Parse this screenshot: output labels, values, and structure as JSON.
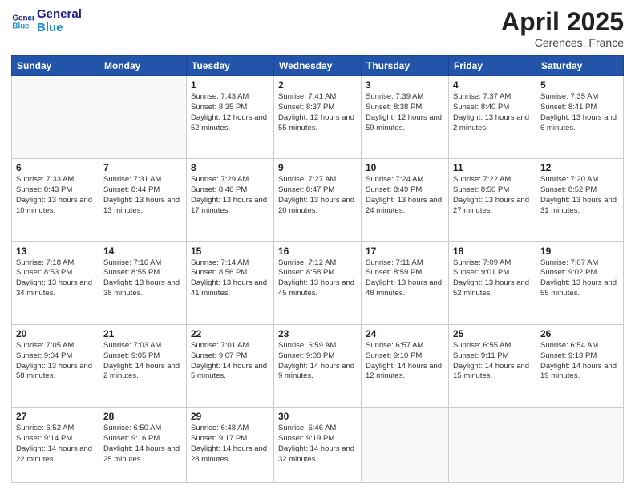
{
  "header": {
    "logo_line1": "General",
    "logo_line2": "Blue",
    "title": "April 2025",
    "subtitle": "Cerences, France"
  },
  "columns": [
    "Sunday",
    "Monday",
    "Tuesday",
    "Wednesday",
    "Thursday",
    "Friday",
    "Saturday"
  ],
  "weeks": [
    [
      {
        "day": "",
        "info": ""
      },
      {
        "day": "",
        "info": ""
      },
      {
        "day": "1",
        "info": "Sunrise: 7:43 AM\nSunset: 8:35 PM\nDaylight: 12 hours and 52 minutes."
      },
      {
        "day": "2",
        "info": "Sunrise: 7:41 AM\nSunset: 8:37 PM\nDaylight: 12 hours and 55 minutes."
      },
      {
        "day": "3",
        "info": "Sunrise: 7:39 AM\nSunset: 8:38 PM\nDaylight: 12 hours and 59 minutes."
      },
      {
        "day": "4",
        "info": "Sunrise: 7:37 AM\nSunset: 8:40 PM\nDaylight: 13 hours and 2 minutes."
      },
      {
        "day": "5",
        "info": "Sunrise: 7:35 AM\nSunset: 8:41 PM\nDaylight: 13 hours and 6 minutes."
      }
    ],
    [
      {
        "day": "6",
        "info": "Sunrise: 7:33 AM\nSunset: 8:43 PM\nDaylight: 13 hours and 10 minutes."
      },
      {
        "day": "7",
        "info": "Sunrise: 7:31 AM\nSunset: 8:44 PM\nDaylight: 13 hours and 13 minutes."
      },
      {
        "day": "8",
        "info": "Sunrise: 7:29 AM\nSunset: 8:46 PM\nDaylight: 13 hours and 17 minutes."
      },
      {
        "day": "9",
        "info": "Sunrise: 7:27 AM\nSunset: 8:47 PM\nDaylight: 13 hours and 20 minutes."
      },
      {
        "day": "10",
        "info": "Sunrise: 7:24 AM\nSunset: 8:49 PM\nDaylight: 13 hours and 24 minutes."
      },
      {
        "day": "11",
        "info": "Sunrise: 7:22 AM\nSunset: 8:50 PM\nDaylight: 13 hours and 27 minutes."
      },
      {
        "day": "12",
        "info": "Sunrise: 7:20 AM\nSunset: 8:52 PM\nDaylight: 13 hours and 31 minutes."
      }
    ],
    [
      {
        "day": "13",
        "info": "Sunrise: 7:18 AM\nSunset: 8:53 PM\nDaylight: 13 hours and 34 minutes."
      },
      {
        "day": "14",
        "info": "Sunrise: 7:16 AM\nSunset: 8:55 PM\nDaylight: 13 hours and 38 minutes."
      },
      {
        "day": "15",
        "info": "Sunrise: 7:14 AM\nSunset: 8:56 PM\nDaylight: 13 hours and 41 minutes."
      },
      {
        "day": "16",
        "info": "Sunrise: 7:12 AM\nSunset: 8:58 PM\nDaylight: 13 hours and 45 minutes."
      },
      {
        "day": "17",
        "info": "Sunrise: 7:11 AM\nSunset: 8:59 PM\nDaylight: 13 hours and 48 minutes."
      },
      {
        "day": "18",
        "info": "Sunrise: 7:09 AM\nSunset: 9:01 PM\nDaylight: 13 hours and 52 minutes."
      },
      {
        "day": "19",
        "info": "Sunrise: 7:07 AM\nSunset: 9:02 PM\nDaylight: 13 hours and 55 minutes."
      }
    ],
    [
      {
        "day": "20",
        "info": "Sunrise: 7:05 AM\nSunset: 9:04 PM\nDaylight: 13 hours and 58 minutes."
      },
      {
        "day": "21",
        "info": "Sunrise: 7:03 AM\nSunset: 9:05 PM\nDaylight: 14 hours and 2 minutes."
      },
      {
        "day": "22",
        "info": "Sunrise: 7:01 AM\nSunset: 9:07 PM\nDaylight: 14 hours and 5 minutes."
      },
      {
        "day": "23",
        "info": "Sunrise: 6:59 AM\nSunset: 9:08 PM\nDaylight: 14 hours and 9 minutes."
      },
      {
        "day": "24",
        "info": "Sunrise: 6:57 AM\nSunset: 9:10 PM\nDaylight: 14 hours and 12 minutes."
      },
      {
        "day": "25",
        "info": "Sunrise: 6:55 AM\nSunset: 9:11 PM\nDaylight: 14 hours and 15 minutes."
      },
      {
        "day": "26",
        "info": "Sunrise: 6:54 AM\nSunset: 9:13 PM\nDaylight: 14 hours and 19 minutes."
      }
    ],
    [
      {
        "day": "27",
        "info": "Sunrise: 6:52 AM\nSunset: 9:14 PM\nDaylight: 14 hours and 22 minutes."
      },
      {
        "day": "28",
        "info": "Sunrise: 6:50 AM\nSunset: 9:16 PM\nDaylight: 14 hours and 25 minutes."
      },
      {
        "day": "29",
        "info": "Sunrise: 6:48 AM\nSunset: 9:17 PM\nDaylight: 14 hours and 28 minutes."
      },
      {
        "day": "30",
        "info": "Sunrise: 6:46 AM\nSunset: 9:19 PM\nDaylight: 14 hours and 32 minutes."
      },
      {
        "day": "",
        "info": ""
      },
      {
        "day": "",
        "info": ""
      },
      {
        "day": "",
        "info": ""
      }
    ]
  ]
}
